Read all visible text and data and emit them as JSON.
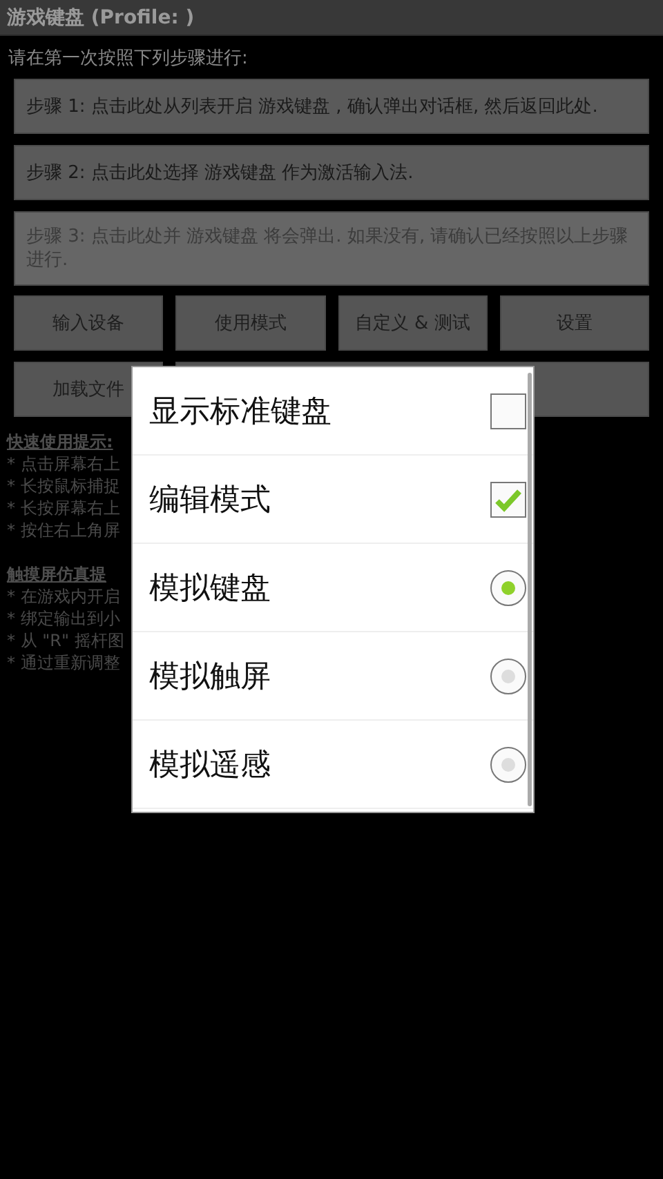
{
  "window": {
    "title": "游戏键盘 (Profile: )"
  },
  "intro": "请在第一次按照下列步骤进行:",
  "steps": [
    {
      "label": "步骤 1: 点击此处从列表开启 游戏键盘 , 确认弹出对话框, 然后返回此处.",
      "disabled": false
    },
    {
      "label": "步骤 2: 点击此处选择 游戏键盘 作为激活输入法.",
      "disabled": false
    },
    {
      "label": "步骤 3: 点击此处并 游戏键盘 将会弹出. 如果没有, 请确认已经按照以上步骤进行.",
      "disabled": true
    }
  ],
  "buttons": [
    {
      "kind": "text",
      "label": "输入设备"
    },
    {
      "kind": "text",
      "label": "使用模式"
    },
    {
      "kind": "text",
      "label": "自定义 & 测试"
    },
    {
      "kind": "text",
      "label": "设置"
    },
    {
      "kind": "text",
      "label": "加载文件"
    },
    {
      "kind": "blank"
    }
  ],
  "hints": [
    {
      "heading": "快速使用提示:",
      "lines": [
        "* 点击屏幕右上",
        "* 长按鼠标捕捉",
        "* 长按屏幕右上",
        "* 按住右上角屏"
      ]
    },
    {
      "heading": "触摸屏仿真提",
      "lines": [
        "* 在游戏内开启",
        "* 绑定输出到小",
        "* 从 \"R\" 摇杆图",
        "* 通过重新调整"
      ]
    }
  ],
  "dialog": {
    "items": [
      {
        "kind": "checkbox",
        "label": "显示标准键盘",
        "checked": false
      },
      {
        "kind": "checkbox",
        "label": "编辑模式",
        "checked": true
      },
      {
        "kind": "radio",
        "label": "模拟键盘",
        "selected": true
      },
      {
        "kind": "radio",
        "label": "模拟触屏",
        "selected": false
      },
      {
        "kind": "radio",
        "label": "模拟遥感",
        "selected": false
      }
    ]
  }
}
